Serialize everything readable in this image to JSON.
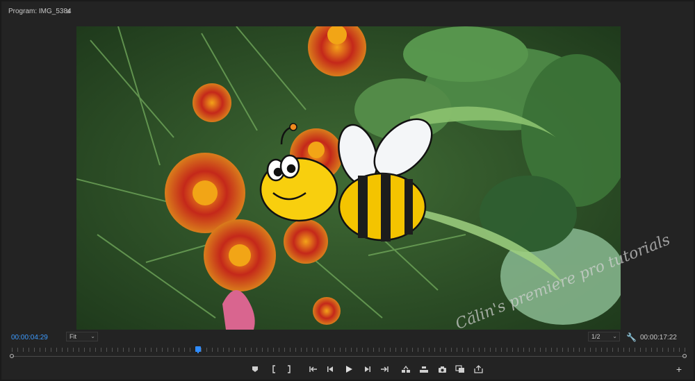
{
  "panel": {
    "title": "Program: IMG_5384",
    "menu_icon": "hamburger-menu-icon"
  },
  "timecodes": {
    "current": "00:00:04:29",
    "duration": "00:00:17:22"
  },
  "zoom": {
    "selected": "Fit"
  },
  "resolution": {
    "selected": "1/2"
  },
  "playhead": {
    "position_fraction": 0.276
  },
  "watermark": {
    "text": "Călin's premiere pro tutorials"
  },
  "transport": {
    "buttons": [
      {
        "name": "add-marker-button",
        "icon": "marker-icon"
      },
      {
        "name": "mark-in-button",
        "icon": "mark-in-icon"
      },
      {
        "name": "mark-out-button",
        "icon": "mark-out-icon"
      },
      {
        "name": "go-to-in-button",
        "icon": "go-to-in-icon"
      },
      {
        "name": "step-back-button",
        "icon": "step-back-icon"
      },
      {
        "name": "play-button",
        "icon": "play-icon"
      },
      {
        "name": "step-forward-button",
        "icon": "step-forward-icon"
      },
      {
        "name": "go-to-out-button",
        "icon": "go-to-out-icon"
      },
      {
        "name": "lift-button",
        "icon": "lift-icon"
      },
      {
        "name": "extract-button",
        "icon": "extract-icon"
      },
      {
        "name": "export-frame-button",
        "icon": "camera-icon"
      },
      {
        "name": "comparison-view-button",
        "icon": "comparison-icon"
      },
      {
        "name": "export-button",
        "icon": "export-icon"
      }
    ]
  },
  "colors": {
    "timecode_current": "#3d9bff",
    "playhead": "#2f8cff",
    "panel_bg": "#232323"
  }
}
